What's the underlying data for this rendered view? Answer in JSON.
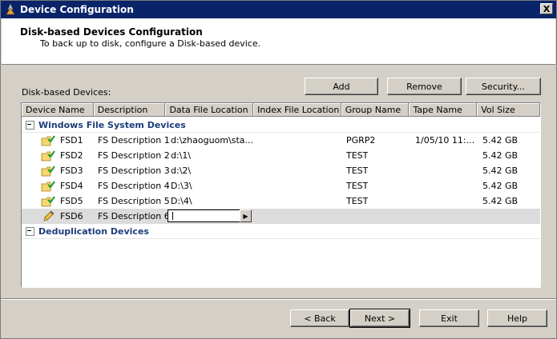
{
  "window": {
    "title": "Device Configuration",
    "close_label": "X"
  },
  "header": {
    "title": "Disk-based Devices Configuration",
    "subtitle": "To back up to disk, configure a Disk-based device."
  },
  "devices_label": "Disk-based Devices:",
  "buttons": {
    "add": "Add",
    "remove": "Remove",
    "security": "Security...",
    "back": "< Back",
    "next": "Next >",
    "exit": "Exit",
    "help": "Help"
  },
  "grid": {
    "columns": [
      "Device Name",
      "Description",
      "Data File Location",
      "Index File Location",
      "Group Name",
      "Tape Name",
      "Vol Size"
    ],
    "groups": [
      {
        "label": "Windows File System Devices",
        "rows": [
          {
            "name": "FSD1",
            "description": "FS Description 1",
            "data_location": "d:\\zhaoguom\\sta...",
            "index_location": "",
            "group": "PGRP2",
            "tape": "1/05/10 11:...",
            "vol_size": "5.42 GB",
            "icon": "folder-check-icon"
          },
          {
            "name": "FSD2",
            "description": "FS Description 2",
            "data_location": "d:\\1\\",
            "index_location": "",
            "group": "TEST",
            "tape": "",
            "vol_size": "5.42 GB",
            "icon": "folder-check-icon"
          },
          {
            "name": "FSD3",
            "description": "FS Description 3",
            "data_location": "d:\\2\\",
            "index_location": "",
            "group": "TEST",
            "tape": "",
            "vol_size": "5.42 GB",
            "icon": "folder-check-icon"
          },
          {
            "name": "FSD4",
            "description": "FS Description 4",
            "data_location": "D:\\3\\",
            "index_location": "",
            "group": "TEST",
            "tape": "",
            "vol_size": "5.42 GB",
            "icon": "folder-check-icon"
          },
          {
            "name": "FSD5",
            "description": "FS Description 5",
            "data_location": "D:\\4\\",
            "index_location": "",
            "group": "TEST",
            "tape": "",
            "vol_size": "5.42 GB",
            "icon": "folder-check-icon"
          },
          {
            "name": "FSD6",
            "description": "FS Description 6",
            "data_location": "",
            "index_location": "",
            "group": "",
            "tape": "",
            "vol_size": "",
            "icon": "pencil-icon"
          }
        ]
      },
      {
        "label": "Deduplication Devices",
        "rows": []
      }
    ]
  }
}
